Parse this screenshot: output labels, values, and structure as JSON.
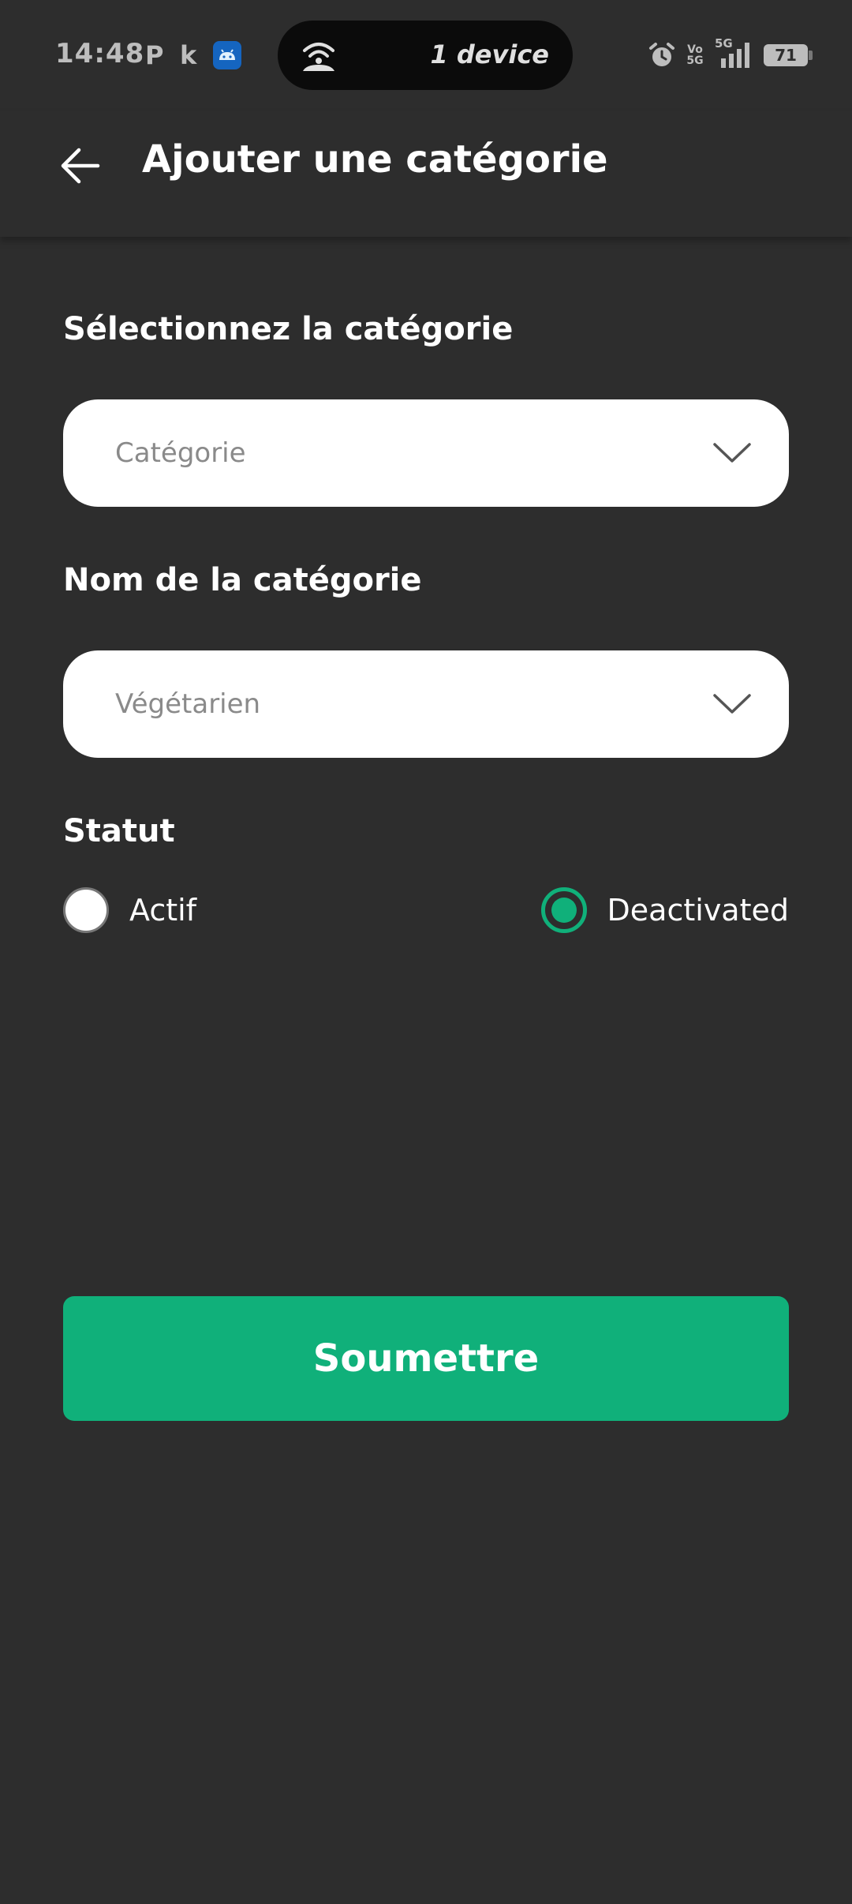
{
  "status_bar": {
    "time": "14:48",
    "p_icon_text": "P",
    "k_icon_text": "k",
    "hotspot_text": "1 device",
    "network_text": "5G",
    "volte_text": "Vo 5G",
    "battery_level": "71"
  },
  "header": {
    "title": "Ajouter une catégorie"
  },
  "form": {
    "category_section_label": "Sélectionnez la catégorie",
    "category_select": {
      "value": "Catégorie"
    },
    "name_section_label": "Nom de la catégorie",
    "name_select": {
      "value": "Végétarien"
    },
    "status_label": "Statut",
    "status_options": [
      {
        "label": "Actif",
        "checked": false
      },
      {
        "label": "Deactivated",
        "checked": true
      }
    ],
    "submit_label": "Soumettre"
  },
  "colors": {
    "background": "#2d2d2d",
    "accent": "#10b07a",
    "text": "#ffffff",
    "placeholder": "#8a8a8a"
  }
}
